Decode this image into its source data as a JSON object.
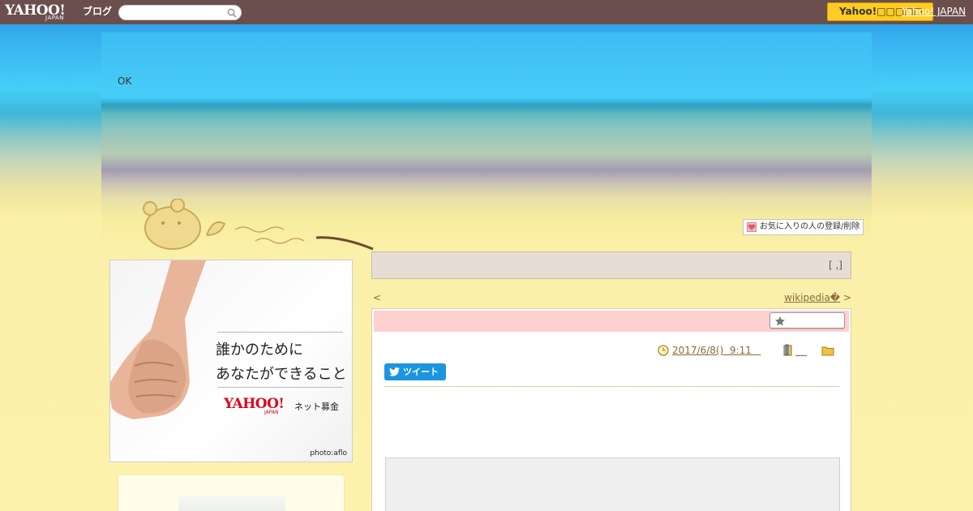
{
  "topbar": {
    "logo_text": "YAHOO!",
    "logo_sub": "JAPAN",
    "blog_label": "ブログ",
    "search": {
      "value": "",
      "placeholder": ""
    },
    "yahoo_button_label": "Yahoo!□□□□□",
    "yahoo_japan_link": "Yahoo! JAPAN"
  },
  "header": {
    "status_text": "OK",
    "favorite_button_label": "お気に入りの人の登録/削除"
  },
  "sidebar": {
    "ad": {
      "headline_line1": "誰かのために",
      "headline_line2": "あなたができること",
      "brand_logo": "YAHOO!",
      "brand_sub": "JAPAN",
      "donation_label": "ネット募金",
      "photo_credit": "photo:aflo"
    }
  },
  "main": {
    "notice_text": "[ ,]",
    "nav": {
      "prev_arrow": "<",
      "prev_link": "",
      "next_link": "wikipedia�",
      "next_arrow": ">"
    },
    "article": {
      "title": "",
      "date": "2017/6/8()  9:11   ",
      "tweet_label": "ツイート"
    }
  }
}
